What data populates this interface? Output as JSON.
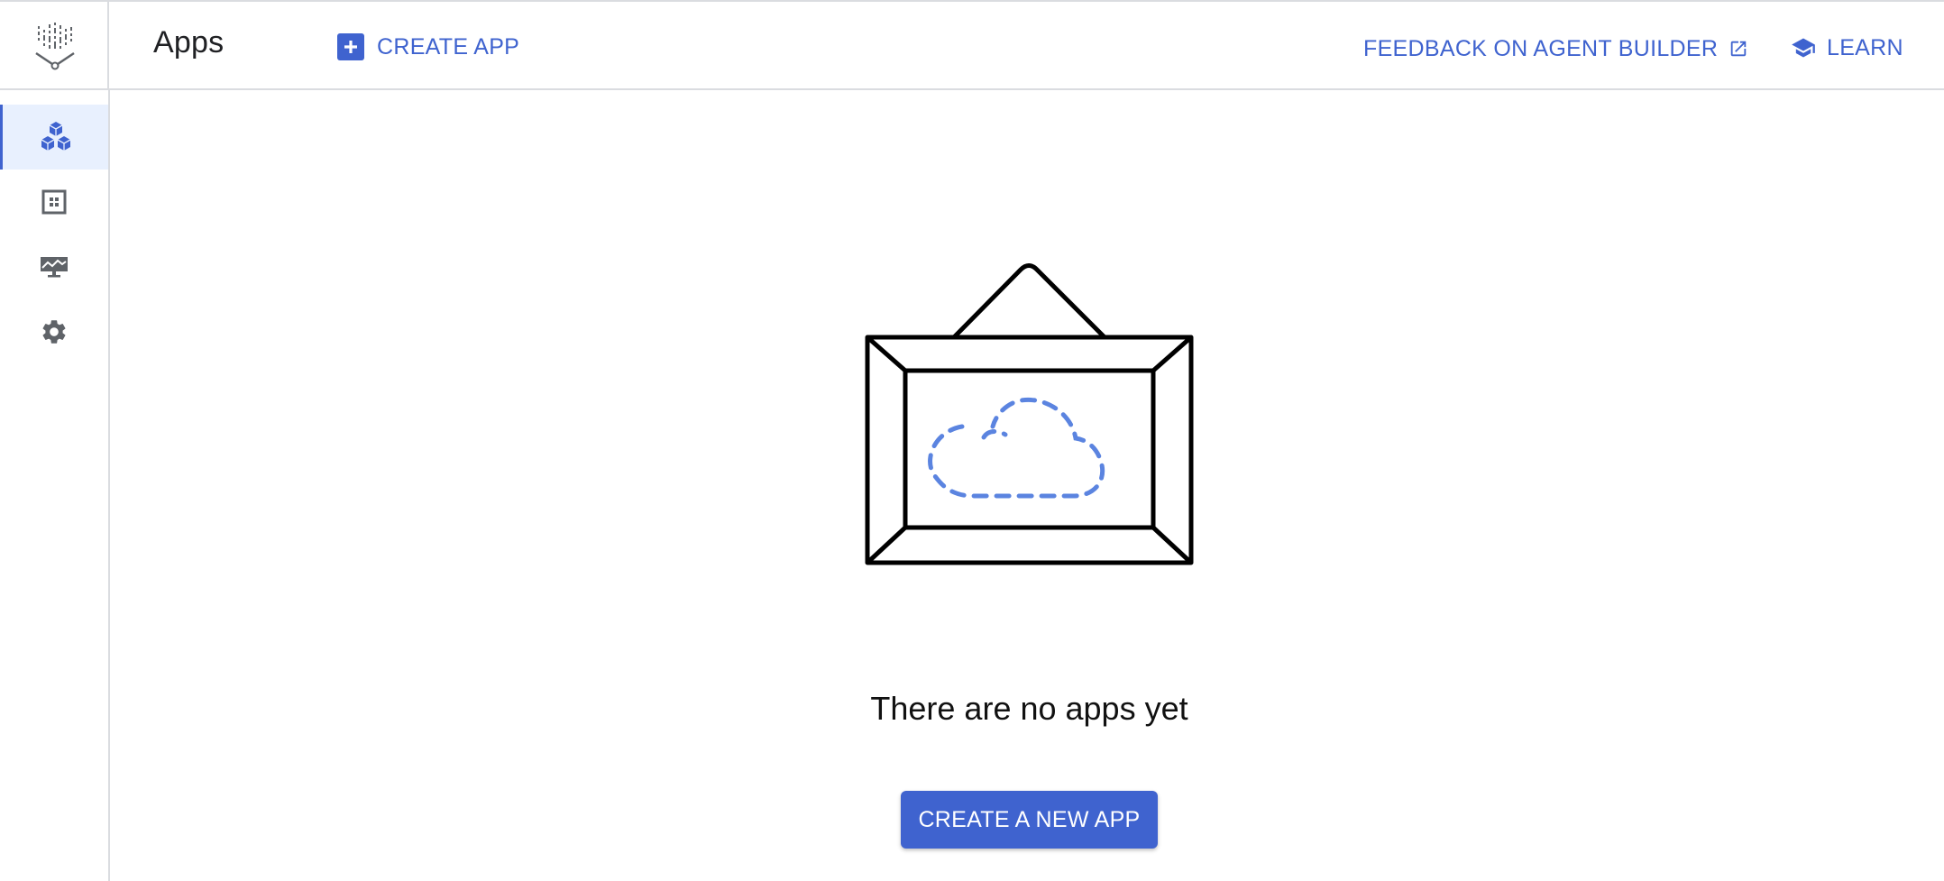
{
  "header": {
    "title": "Apps",
    "create_app_label": "CREATE APP",
    "feedback_label": "FEEDBACK ON AGENT BUILDER",
    "learn_label": "LEARN"
  },
  "sidebar": {
    "items": [
      {
        "icon": "apps-cubes-icon",
        "active": true
      },
      {
        "icon": "grid-box-icon",
        "active": false
      },
      {
        "icon": "monitor-chart-icon",
        "active": false
      },
      {
        "icon": "gear-icon",
        "active": false
      }
    ]
  },
  "empty_state": {
    "message": "There are no apps yet",
    "button_label": "CREATE A NEW APP",
    "illustration": "framed-cloud"
  },
  "colors": {
    "accent": "#3f63cf",
    "active_bg": "#e8f0fe",
    "border": "#dadce0",
    "cloud": "#5b84e0"
  }
}
